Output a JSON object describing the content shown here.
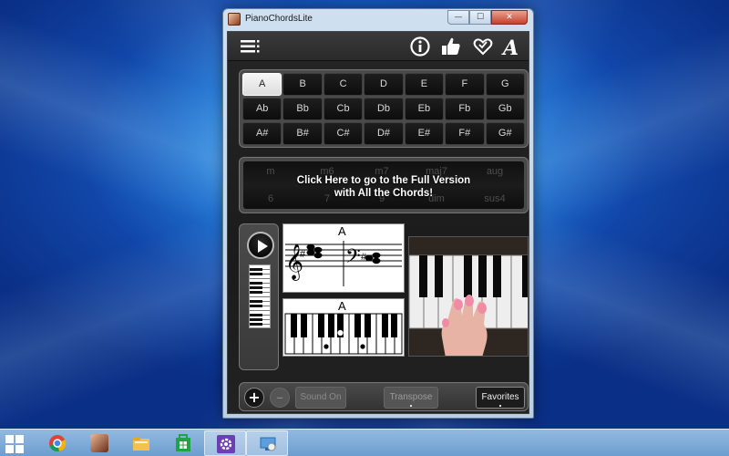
{
  "window": {
    "title": "PianoChordsLite",
    "caption": {
      "minimize": "—",
      "maximize": "☐",
      "close": "✕"
    }
  },
  "toolbar": {
    "icons": [
      "menu-icon",
      "info-icon",
      "thumbs-up-icon",
      "heart-icon",
      "font-icon"
    ]
  },
  "keys": {
    "rows": [
      [
        "A",
        "B",
        "C",
        "D",
        "E",
        "F",
        "G"
      ],
      [
        "Ab",
        "Bb",
        "Cb",
        "Db",
        "Eb",
        "Fb",
        "Gb"
      ],
      [
        "A#",
        "B#",
        "C#",
        "D#",
        "E#",
        "F#",
        "G#"
      ]
    ],
    "selected": "A"
  },
  "chord_types": {
    "top_row": [
      "m",
      "m6",
      "m7",
      "maj7",
      "aug"
    ],
    "bottom_row": [
      "6",
      "7",
      "9",
      "dim",
      "sus4"
    ],
    "promo_line1": "Click Here to go to the Full Version",
    "promo_line2": "with All the Chords!"
  },
  "notation": {
    "chord": "A",
    "treble_accidental": "#",
    "bass_accidental": "#"
  },
  "keyboard_diagram": {
    "chord": "A"
  },
  "bottom_bar": {
    "add": "+",
    "remove": "–",
    "sound": "Sound On",
    "transpose": "Transpose",
    "favorites": "Favorites"
  },
  "taskbar": {
    "items": [
      "chrome-icon",
      "piano-chords-icon",
      "file-explorer-icon",
      "store-icon",
      "settings-icon",
      "control-panel-icon"
    ]
  },
  "colors": {
    "accent_dark": "#1b1b1b",
    "selected_key": "#f2f2f2",
    "desktop_blue": "#1f73d2"
  }
}
